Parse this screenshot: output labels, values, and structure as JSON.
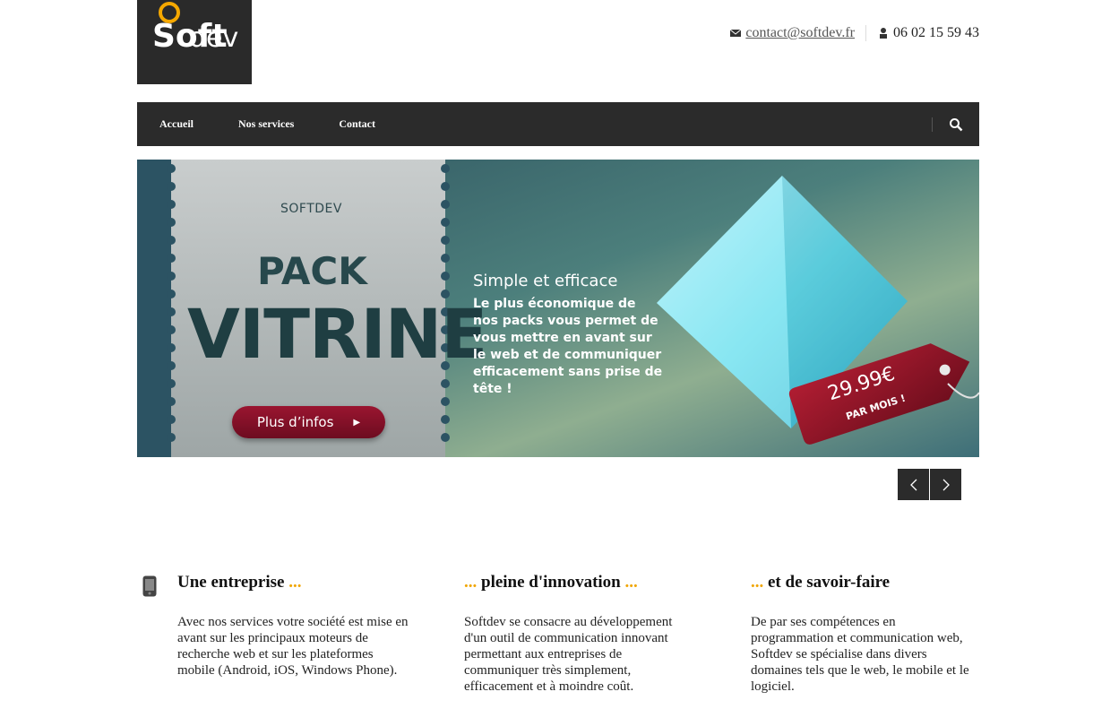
{
  "header": {
    "logo": {
      "line1": "Soft",
      "line2": "dev"
    },
    "email": "contact@softdev.fr",
    "phone": "06 02 15 59 43"
  },
  "nav": {
    "items": [
      {
        "label": "Accueil"
      },
      {
        "label": "Nos services"
      },
      {
        "label": "Contact"
      }
    ]
  },
  "slide": {
    "brand": "SOFTDEV",
    "title_line1": "PACK",
    "title_line2": "VITRINE",
    "button_label": "Plus d’infos",
    "tagline": "Simple et efficace",
    "description": "Le plus économique de\nnos packs vous permet de\nvous mettre en avant sur\nle web et de communiquer\nefficacement sans prise de tête !",
    "price": "29.99€",
    "price_period": "PAR MOIS !"
  },
  "features": [
    {
      "title": "Une entreprise",
      "dots_after": "...",
      "dots_before": "",
      "text": "Avec nos services votre société est mise en avant sur les principaux moteurs de recherche web et sur les plateformes mobile (Android, iOS, Windows Phone)."
    },
    {
      "title": "pleine d'innovation",
      "dots_before": "...",
      "dots_after": "...",
      "text": "Softdev se consacre au développement d'un outil de communication innovant permettant aux entreprises de communiquer très simplement, efficacement et à moindre coût."
    },
    {
      "title": "et de savoir-faire",
      "dots_before": "...",
      "dots_after": "",
      "text": "De par ses compétences en programmation et communication web, Softdev se spécialise dans divers domaines tels que le web, le mobile et le logiciel."
    }
  ],
  "colors": {
    "accent": "#f0a500",
    "nav_bg": "#2b2b2b",
    "button": "#8b1028"
  },
  "icons": {
    "email": "envelope-icon",
    "phone": "person-icon",
    "search": "search-icon",
    "feature1": "mobile-phone-icon",
    "prev": "chevron-left-icon",
    "next": "chevron-right-icon"
  }
}
